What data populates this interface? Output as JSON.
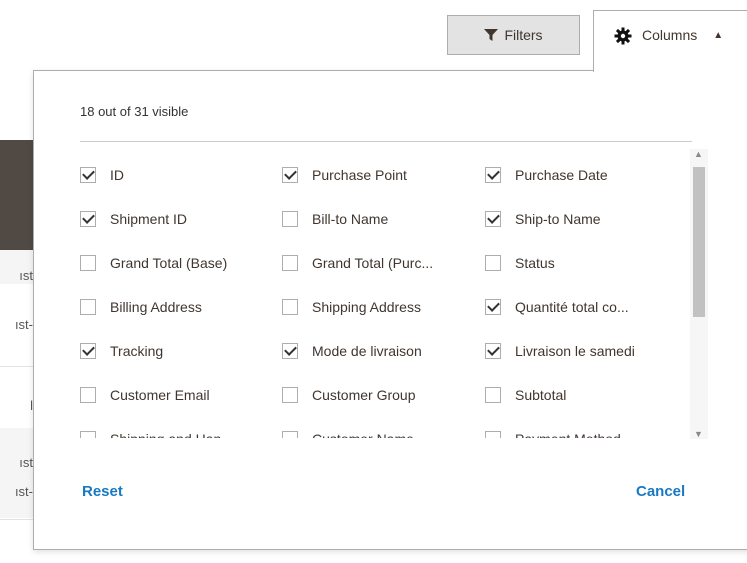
{
  "toolbar": {
    "filters_label": "Filters",
    "columns_label": "Columns"
  },
  "background_cells": [
    "ıst",
    "ıst-",
    "l",
    "ıst",
    "ıst-"
  ],
  "panel": {
    "visible_count": "18 out of 31 visible",
    "columns": [
      {
        "label": "ID",
        "checked": true
      },
      {
        "label": "Purchase Point",
        "checked": true
      },
      {
        "label": "Purchase Date",
        "checked": true
      },
      {
        "label": "Shipment ID",
        "checked": true
      },
      {
        "label": "Bill-to Name",
        "checked": false
      },
      {
        "label": "Ship-to Name",
        "checked": true
      },
      {
        "label": "Grand Total (Base)",
        "checked": false
      },
      {
        "label": "Grand Total (Purc...",
        "checked": false
      },
      {
        "label": "Status",
        "checked": false
      },
      {
        "label": "Billing Address",
        "checked": false
      },
      {
        "label": "Shipping Address",
        "checked": false
      },
      {
        "label": "Quantité total co...",
        "checked": true
      },
      {
        "label": "Tracking",
        "checked": true
      },
      {
        "label": "Mode de livraison",
        "checked": true
      },
      {
        "label": "Livraison le samedi",
        "checked": true
      },
      {
        "label": "Customer Email",
        "checked": false
      },
      {
        "label": "Customer Group",
        "checked": false
      },
      {
        "label": "Subtotal",
        "checked": false
      },
      {
        "label": "Shipping and Han...",
        "checked": false
      },
      {
        "label": "Customer Name",
        "checked": false
      },
      {
        "label": "Payment Method",
        "checked": false
      }
    ],
    "reset_label": "Reset",
    "cancel_label": "Cancel"
  },
  "colors": {
    "accent_link": "#1979c3",
    "dark_header": "#514943",
    "border": "#adadad"
  }
}
